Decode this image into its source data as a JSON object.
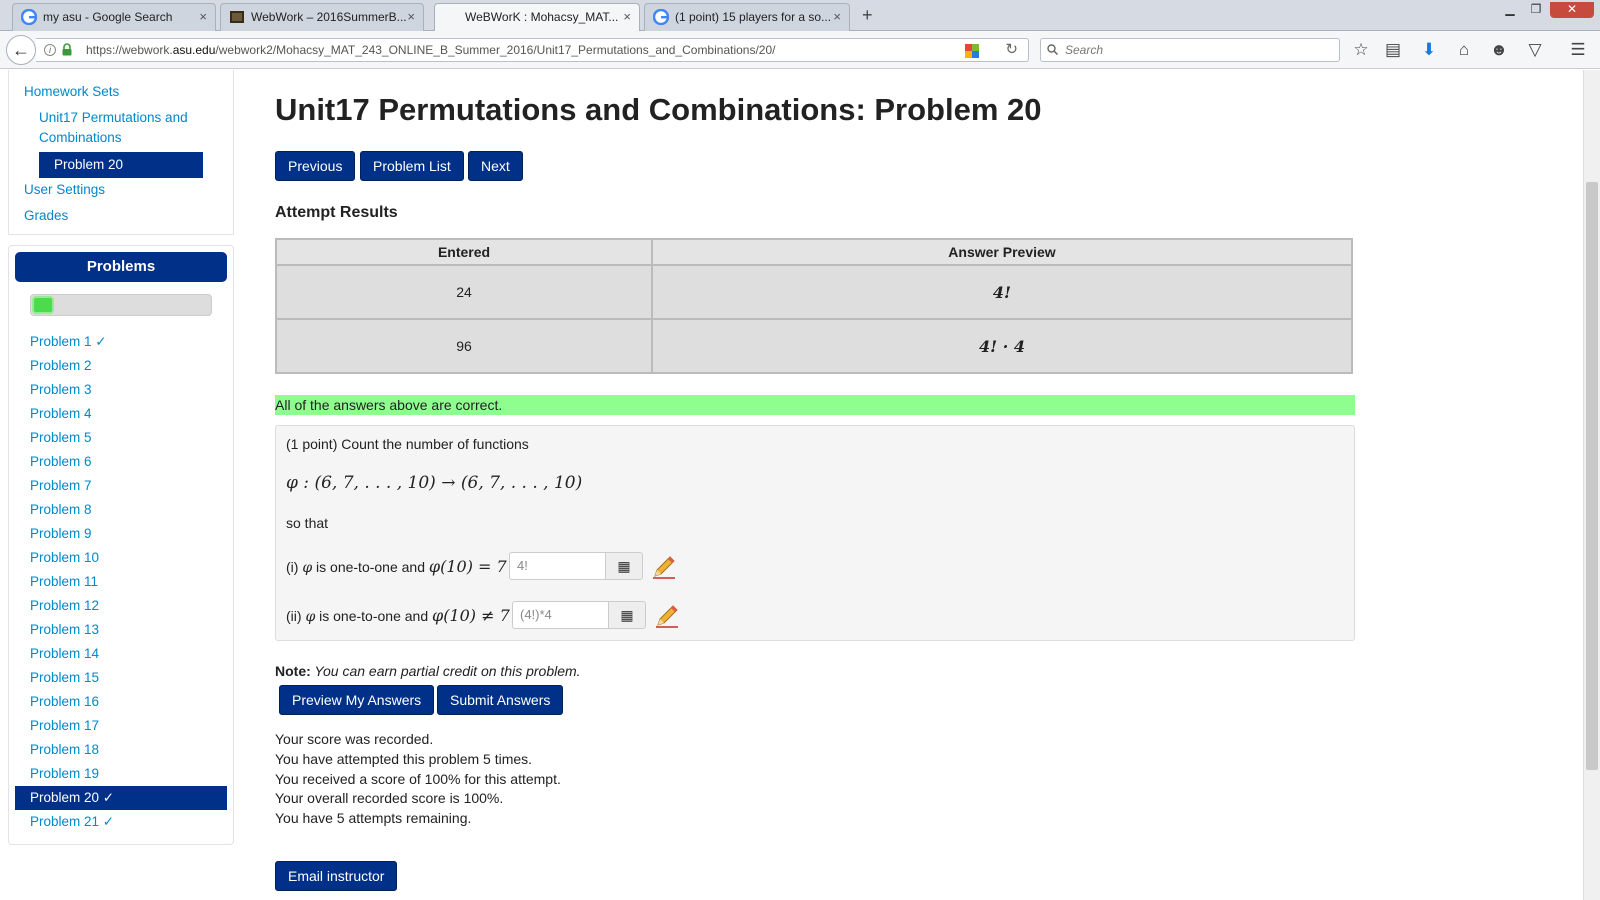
{
  "browser": {
    "tabs": [
      {
        "label": "my asu - Google Search",
        "favicon": "google-icon",
        "active": false
      },
      {
        "label": "WebWork – 2016SummerB...",
        "favicon": "blackboard-icon",
        "active": false
      },
      {
        "label": "WeBWorK : Mohacsy_MAT...",
        "favicon": "",
        "active": true
      },
      {
        "label": "(1 point) 15 players for a so...",
        "favicon": "google-icon",
        "active": false
      }
    ],
    "new_tab": "+",
    "close_glyph": "×",
    "url": {
      "prefix": "https://webwork.",
      "host": "asu.edu",
      "path": "/webwork2/Mohacsy_MAT_243_ONLINE_B_Summer_2016/Unit17_Permutations_and_Combinations/20/"
    },
    "search_placeholder": "Search"
  },
  "sidebar": {
    "nav": [
      {
        "label": "Homework Sets",
        "level": 0,
        "active": false
      },
      {
        "label": "Unit17 Permutations and Combinations",
        "level": 1,
        "active": false
      },
      {
        "label": "Problem 20",
        "level": 2,
        "active": true
      },
      {
        "label": "User Settings",
        "level": 0,
        "active": false
      },
      {
        "label": "Grades",
        "level": 0,
        "active": false
      }
    ],
    "problems_header": "Problems",
    "progress_fraction": 0.12,
    "problems": [
      "Problem 1 ✓",
      "Problem 2",
      "Problem 3",
      "Problem 4",
      "Problem 5",
      "Problem 6",
      "Problem 7",
      "Problem 8",
      "Problem 9",
      "Problem 10",
      "Problem 11",
      "Problem 12",
      "Problem 13",
      "Problem 14",
      "Problem 15",
      "Problem 16",
      "Problem 17",
      "Problem 18",
      "Problem 19",
      "Problem 20 ✓",
      "Problem 21 ✓"
    ],
    "active_problem_index": 19
  },
  "main": {
    "title": "Unit17 Permutations and Combinations: Problem 20",
    "nav_buttons": {
      "previous": "Previous",
      "problem_list": "Problem List",
      "next": "Next"
    },
    "attempt_heading": "Attempt Results",
    "results": {
      "headers": [
        "Entered",
        "Answer Preview"
      ],
      "rows": [
        {
          "entered": "24",
          "preview": "4!"
        },
        {
          "entered": "96",
          "preview": "4! · 4"
        }
      ]
    },
    "correct_message": "All of the answers above are correct.",
    "problem": {
      "intro": "(1 point) Count the number of functions",
      "formula": "φ : (6, 7, . . . , 10) → (6, 7, . . . , 10)",
      "so_that": "so that",
      "part_i_prefix": "(i)",
      "part_i_phi": "φ",
      "part_i_text": " is one-to-one and ",
      "part_i_math": "φ(10) = 7",
      "part_i_value": "4!",
      "part_ii_prefix": "(ii)",
      "part_ii_phi": "φ",
      "part_ii_text": " is one-to-one and ",
      "part_ii_math": "φ(10) ≠ 7",
      "part_ii_value": "(4!)*4",
      "grid_glyph": "▦"
    },
    "note_label": "Note:",
    "note_text": " You can earn partial credit on this problem.",
    "preview_button": "Preview My Answers",
    "submit_button": "Submit Answers",
    "score_lines": [
      "Your score was recorded.",
      "You have attempted this problem 5 times.",
      "You received a score of 100% for this attempt.",
      "Your overall recorded score is 100%.",
      "You have 5 attempts remaining."
    ],
    "email_button": "Email instructor"
  }
}
